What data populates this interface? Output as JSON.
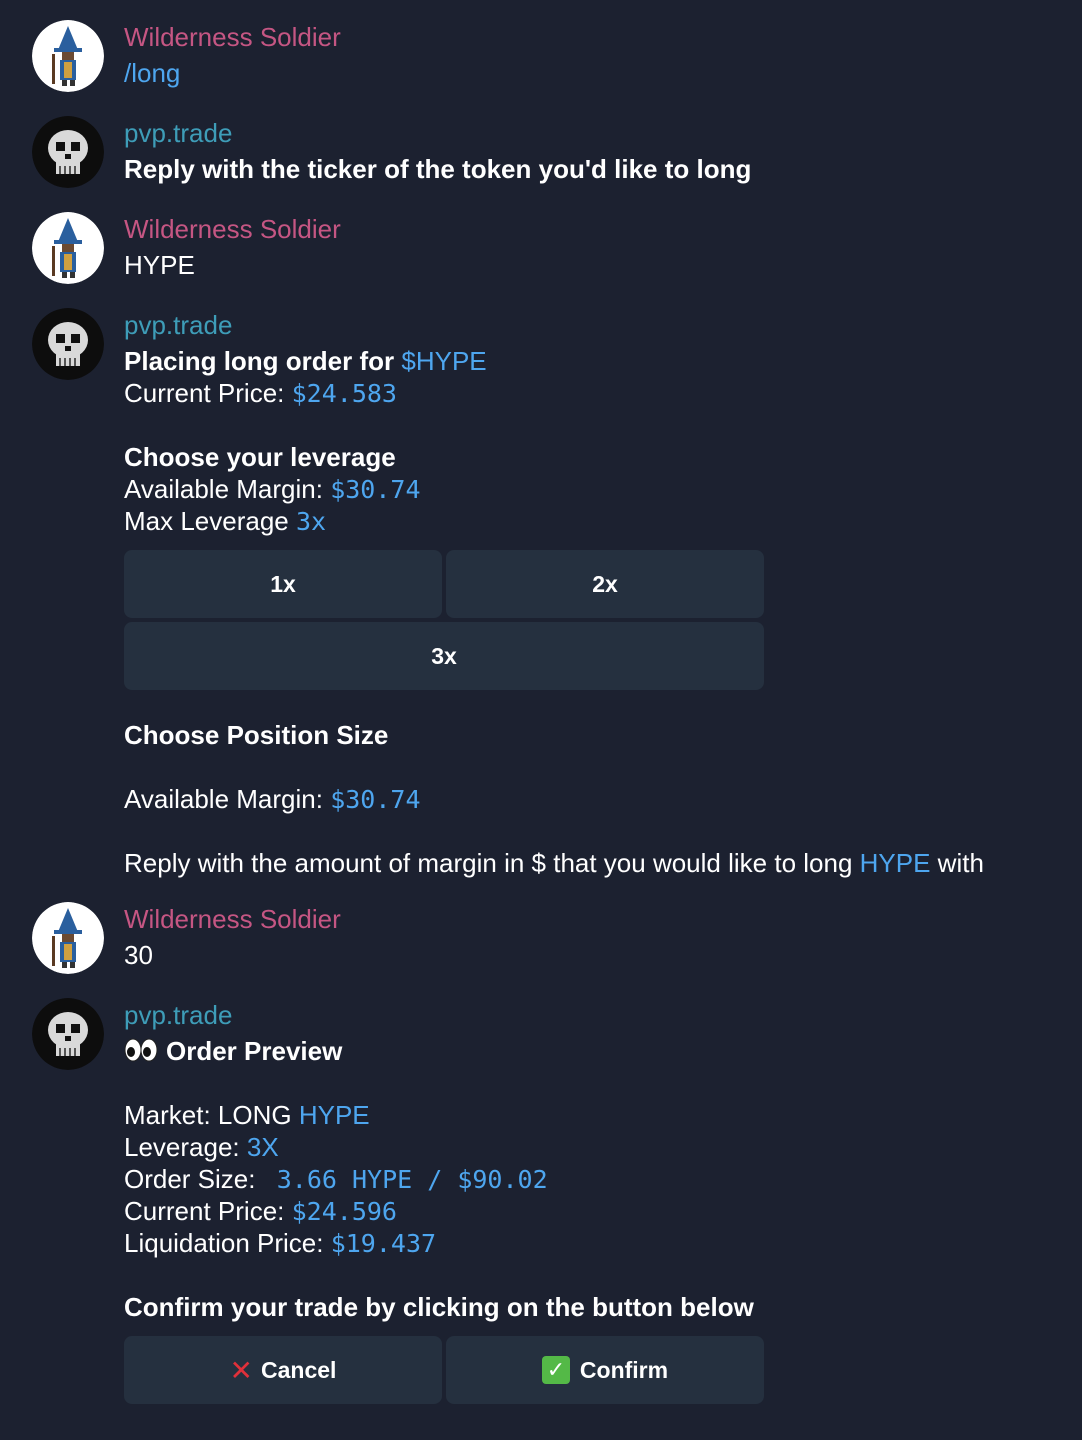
{
  "messages": [
    {
      "sender": "Wilderness Soldier",
      "text": "/long"
    },
    {
      "sender": "pvp.trade",
      "text": "Reply with the ticker of the token you'd like to long"
    },
    {
      "sender": "Wilderness Soldier",
      "text": "HYPE"
    },
    {
      "sender": "pvp.trade",
      "placing_prefix": "Placing long order for ",
      "placing_ticker": "$HYPE",
      "current_price_label": "Current Price: ",
      "current_price": "$24.583",
      "choose_leverage": "Choose your leverage",
      "available_margin_label": "Available Margin: ",
      "available_margin": "$30.74",
      "max_leverage_label": "Max Leverage ",
      "max_leverage": "3x",
      "leverage_buttons": [
        "1x",
        "2x",
        "3x"
      ],
      "choose_position": "Choose Position Size",
      "available_margin_label_2": "Available Margin: ",
      "available_margin_2": "$30.74",
      "reply_prefix": "Reply with the amount of margin in $ that you would like to long ",
      "reply_ticker": "HYPE",
      "reply_suffix": " with"
    },
    {
      "sender": "Wilderness Soldier",
      "text": "30"
    },
    {
      "sender": "pvp.trade",
      "preview_title": "Order Preview",
      "market_label": "Market: LONG ",
      "market_ticker": "HYPE",
      "leverage_label": "Leverage: ",
      "leverage_value": "3X",
      "order_size_label": "Order Size: ",
      "order_size_value": "3.66 HYPE / $90.02",
      "current_price_label": "Current Price: ",
      "current_price": "$24.596",
      "liquidation_label": "Liquidation Price: ",
      "liquidation_price": "$19.437",
      "confirm_prompt": "Confirm your trade by clicking on the button below",
      "cancel_label": "Cancel",
      "confirm_label": "Confirm"
    }
  ],
  "icons": {
    "user_avatar": "wizard-avatar-icon",
    "bot_avatar": "skull-avatar-icon",
    "eyes": "eyes-icon",
    "cross": "cross-mark-icon",
    "check": "check-mark-icon"
  },
  "colors": {
    "background": "#1c2130",
    "user_name": "#c55683",
    "bot_name": "#3e9db8",
    "link": "#4ea6ef",
    "button_bg": "#25303f"
  }
}
